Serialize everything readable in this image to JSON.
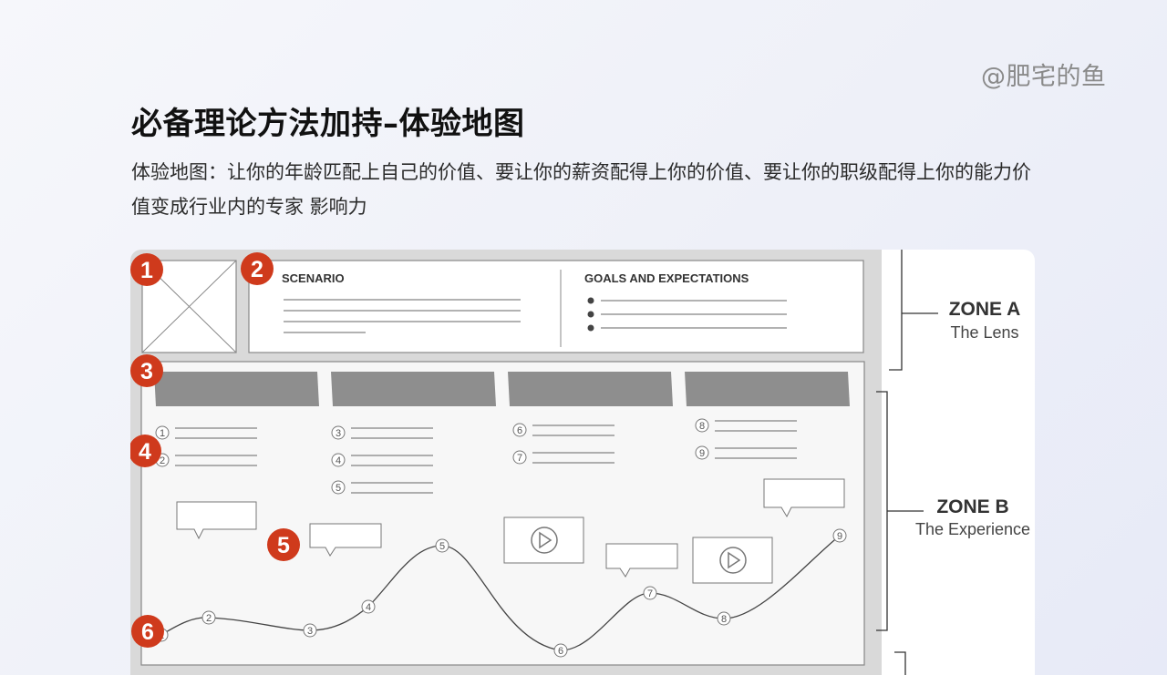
{
  "watermark": "@肥宅的鱼",
  "title": "必备理论方法加持–体验地图",
  "description": "体验地图：让你的年龄匹配上自己的价值、要让你的薪资配得上你的价值、要让你的职级配得上你的能力价值变成行业内的专家 影响力",
  "diagram": {
    "badges": [
      "1",
      "2",
      "3",
      "4",
      "5",
      "6"
    ],
    "scenario_label": "SCENARIO",
    "goals_label": "GOALS AND EXPECTATIONS",
    "zones": [
      {
        "title": "ZONE A",
        "subtitle": "The Lens"
      },
      {
        "title": "ZONE B",
        "subtitle": "The Experience"
      }
    ],
    "phase_steps": [
      [
        "1",
        "2"
      ],
      [
        "3",
        "4",
        "5"
      ],
      [
        "6",
        "7"
      ],
      [
        "8",
        "9"
      ]
    ],
    "curve_points": [
      "1",
      "2",
      "3",
      "4",
      "5",
      "6",
      "7",
      "8",
      "9"
    ],
    "colors": {
      "badge": "#cf3a1c",
      "phase_bar": "#8e8e8e",
      "frame": "#d9d9d9",
      "line": "#444444"
    }
  }
}
